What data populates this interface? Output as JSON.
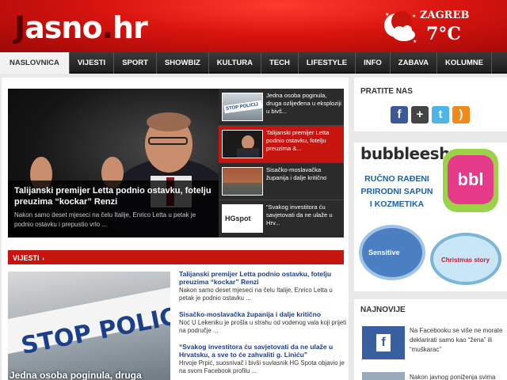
{
  "header": {
    "logo_prefix": "J",
    "logo_rest": "asno",
    "logo_dot": ".",
    "logo_tld": "hr",
    "weather": {
      "city": "ZAGREB",
      "temperature": "7°C",
      "icon": "moon-cloud-icon"
    }
  },
  "nav": {
    "items": [
      "NASLOVNICA",
      "VIJESTI",
      "SPORT",
      "SHOWBIZ",
      "KULTURA",
      "TECH",
      "LIFESTYLE",
      "INFO",
      "ZABAVA",
      "KOLUMNE"
    ],
    "active": "NASLOVNICA"
  },
  "slider": {
    "main_title": "Talijanski premijer Letta podnio ostavku, fotelju preuzima “kockar” Renzi",
    "main_excerpt": "Nakon samo deset mjeseci na čelu Italije, Enrico Letta u petak je podnio ostavku i prepustio vrlo ...",
    "thumbs": [
      {
        "text": "Jedna osoba poginula, druga ozlijeđena u eksploziji u bivš..."
      },
      {
        "text": "Talijanski premijer Letta podnio ostavku, fotelju preuzima &..."
      },
      {
        "text": "Sisačko-moslavačka županija i dalje kritično"
      },
      {
        "text": "“Svakog investitora ću savjetovati da ne ulaže u Hrv..."
      }
    ],
    "thumb_logo_text": "HGspot"
  },
  "section": {
    "title": "VIJESTI",
    "arrow": "›"
  },
  "news_image_text": "STOP POLICIJA",
  "news_image_caption": "Jedna osoba poginula, druga",
  "news": [
    {
      "title": "Talijanski premijer Letta podnio ostavku, fotelju preuzima “kockar” Renzi",
      "text": "Nakon samo deset mjeseci na čelu Italije, Enrico Letta u petak je podnio ostavku ..."
    },
    {
      "title": "Sisačko-moslavačka županija i dalje kritično",
      "text": "Noć U Lekeniku je prošla u strahu od vodenog vala koji prijeti na područje ..."
    },
    {
      "title": "“Svakog investitora ću savjetovati da ne ulaže u Hrvatsku, a sve to će zahvaliti g. Liniću”",
      "text": "Hrvoje Prpić, suosnivač i bivši suvlasnik HG Spota objavio je na svom Facebook profilu ..."
    }
  ],
  "sidebar": {
    "follow_title": "PRATITE NAS",
    "social": [
      {
        "icon": "facebook-icon",
        "glyph": "f",
        "color": "#3b5998"
      },
      {
        "icon": "google-plus-icon",
        "glyph": "+",
        "color": "#444444"
      },
      {
        "icon": "twitter-icon",
        "glyph": "t",
        "color": "#4fb3e8"
      },
      {
        "icon": "rss-icon",
        "glyph": ")",
        "color": "#f08a1c"
      }
    ],
    "ad": {
      "brand": "bubbleesh",
      "lines": [
        "RUČNO RAĐENI",
        "PRIRODNI SAPUN",
        "I KOZMETIKA"
      ],
      "badge": "bbl",
      "product_1": "Sensitive",
      "product_2": "Christmas story"
    },
    "latest_title": "NAJNOVIJE",
    "latest": [
      {
        "text": "Na Facebooku se više ne morate deklarirati samo kao “žena” ili “muškarac”"
      },
      {
        "text": "Nakon javnog poniženja svima"
      }
    ]
  },
  "colors": {
    "brand_red": "#c8140f",
    "nav_dark": "#2a2a2a",
    "link_blue": "#1a3e8c"
  }
}
